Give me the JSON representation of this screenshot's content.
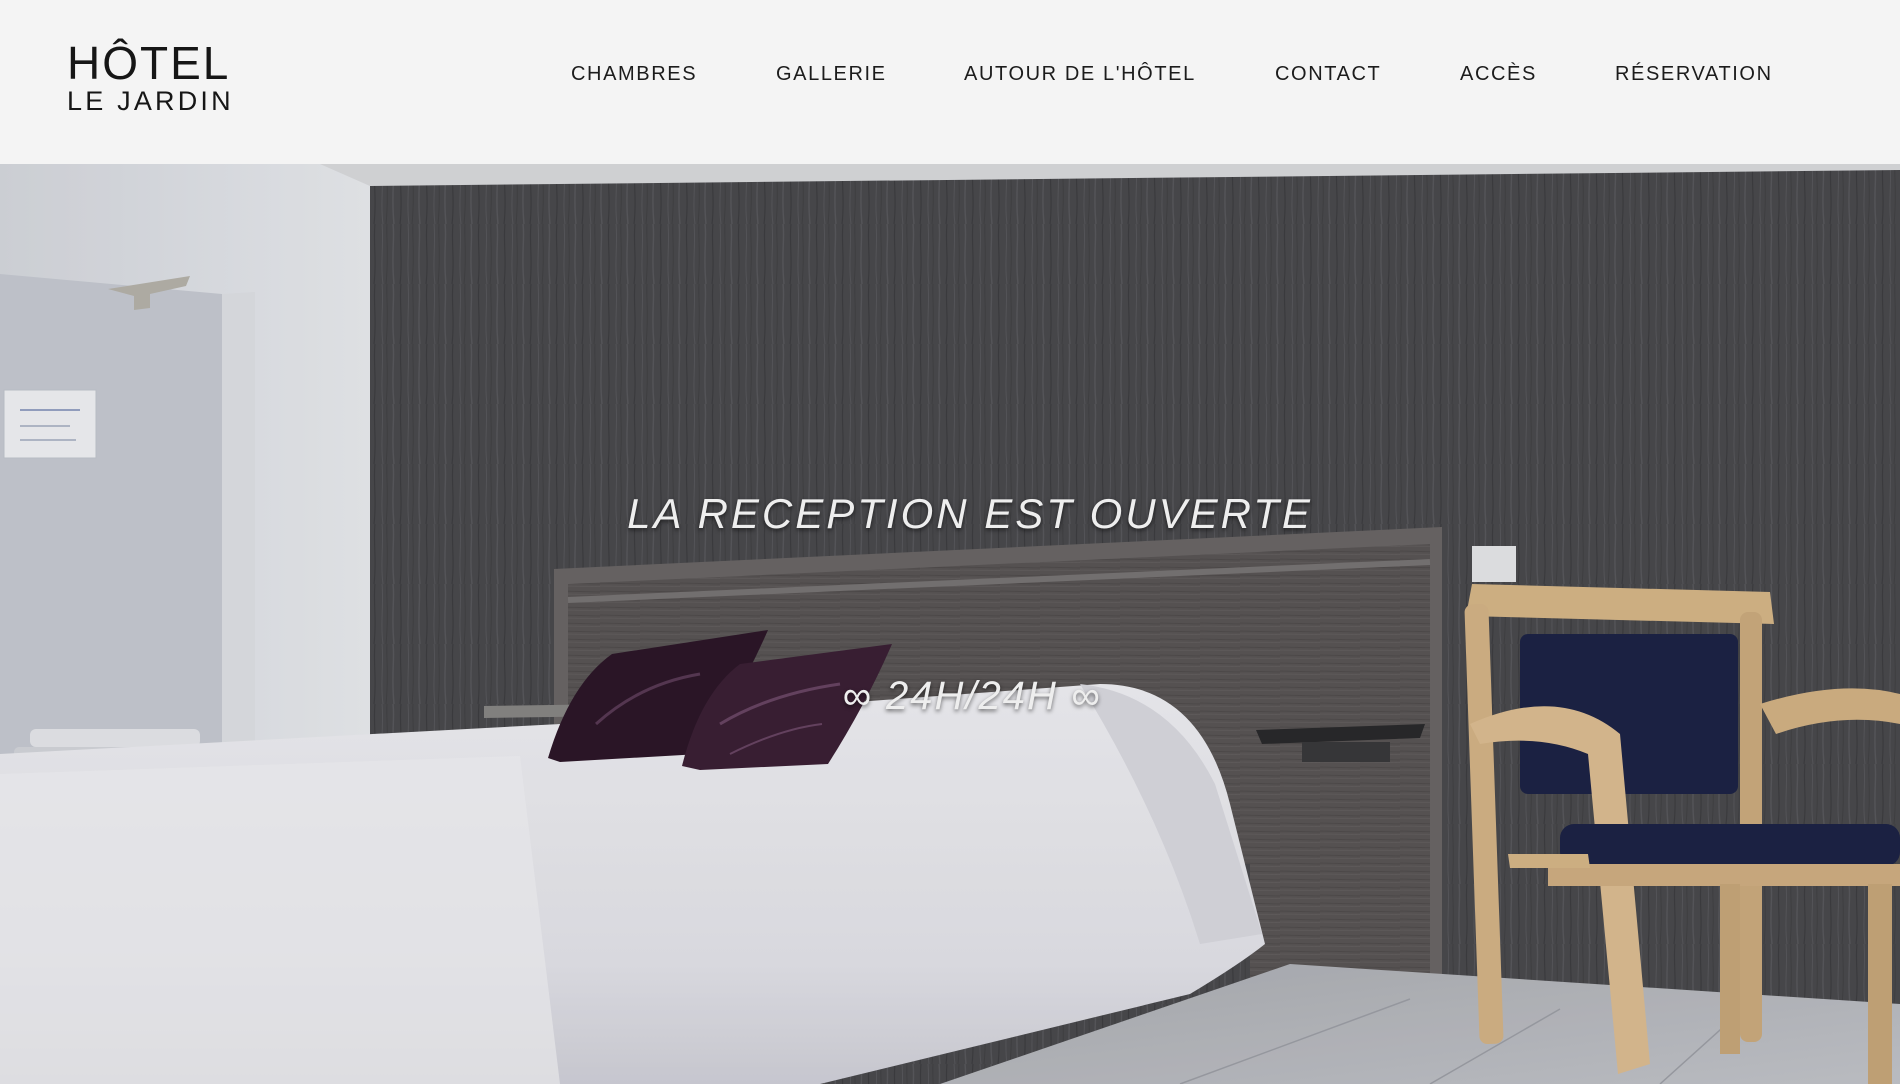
{
  "header": {
    "logo": {
      "line1": "HÔTEL",
      "line2": "LE JARDIN"
    },
    "nav": [
      {
        "label": "CHAMBRES"
      },
      {
        "label": "GALLERIE"
      },
      {
        "label": "AUTOUR DE L'HÔTEL"
      },
      {
        "label": "CONTACT"
      },
      {
        "label": "ACCÈS"
      },
      {
        "label": "RÉSERVATION"
      }
    ]
  },
  "hero": {
    "title": "LA RECEPTION EST OUVERTE",
    "hours": "∞ 24H/24H ∞"
  },
  "colors": {
    "header_background": "#f4f4f4",
    "text_dark": "#161616",
    "hero_text": "#eeeeee",
    "wallpaper": "#4a4a4d",
    "headboard": "#5a5656",
    "bedding": "#eeeef3",
    "cushion": "#3b1f35",
    "chair_wood": "#d9b98a",
    "chair_upholstery": "#1d2447"
  }
}
